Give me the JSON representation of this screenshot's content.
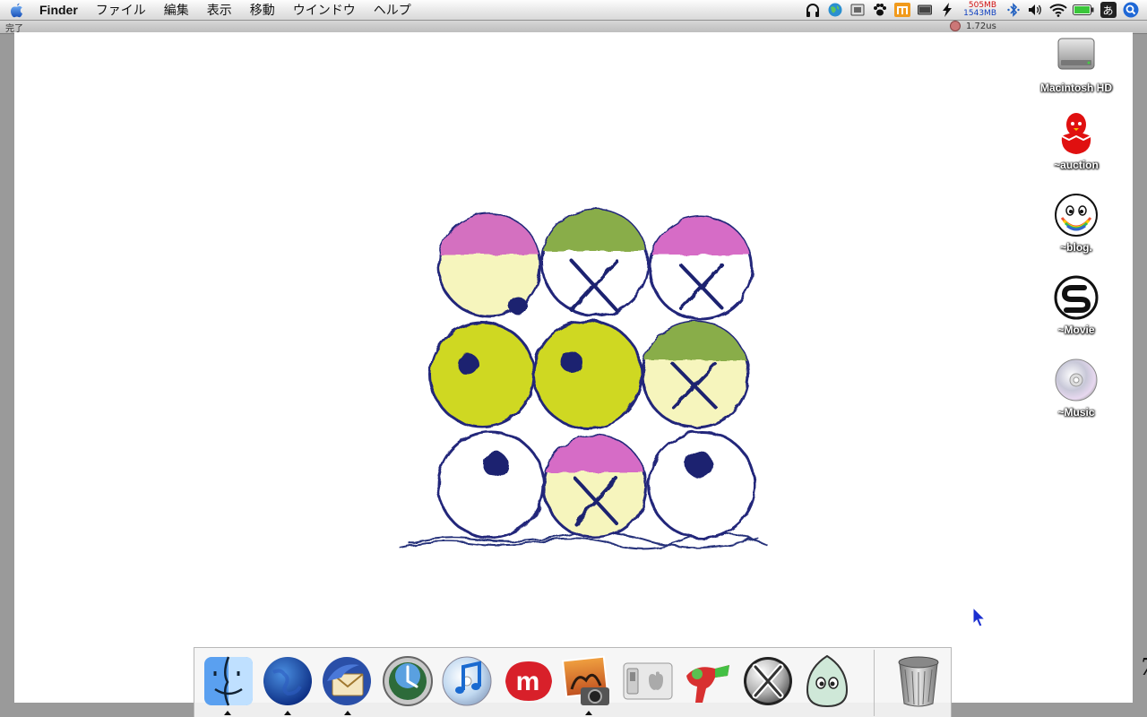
{
  "menubar": {
    "apple_icon": "apple-icon",
    "app_name": "Finder",
    "menus": [
      "ファイル",
      "編集",
      "表示",
      "移動",
      "ウインドウ",
      "ヘルプ"
    ],
    "status_icons": [
      "headphones-icon",
      "globe-icon",
      "display-icon",
      "paw-icon",
      "bars-icon",
      "battery-meter-icon",
      "bolt-icon"
    ],
    "memory_free": "505MB",
    "memory_total": "1543MB",
    "right_icons": [
      "bluetooth-icon",
      "volume-icon",
      "wifi-icon",
      "battery-icon"
    ],
    "input_method": "あ",
    "spotlight_icon": "spotlight-icon"
  },
  "background_window": {
    "title": "完了",
    "time": "1.72us"
  },
  "desktop": {
    "icons": [
      {
        "label": "Macintosh HD",
        "icon": "hard-drive-icon"
      },
      {
        "label": "~auction",
        "icon": "red-bird-icon"
      },
      {
        "label": "~blog.",
        "icon": "smiley-icon"
      },
      {
        "label": "~Movie",
        "icon": "s-logo-icon"
      },
      {
        "label": "~Music",
        "icon": "cd-icon"
      }
    ],
    "edge_glyph": "7"
  },
  "dock": {
    "apps": [
      {
        "name": "Finder",
        "icon": "finder-icon",
        "running": true
      },
      {
        "name": "Firefox",
        "icon": "firefox-icon",
        "running": true
      },
      {
        "name": "Thunderbird",
        "icon": "thunderbird-icon",
        "running": true
      },
      {
        "name": "Time Machine",
        "icon": "time-machine-icon",
        "running": false
      },
      {
        "name": "iTunes",
        "icon": "itunes-icon",
        "running": false
      },
      {
        "name": "Miro",
        "icon": "miro-icon",
        "running": false
      },
      {
        "name": "iPhoto",
        "icon": "iphoto-icon",
        "running": true
      },
      {
        "name": "System Preferences",
        "icon": "switch-icon",
        "running": false
      },
      {
        "name": "Ray Gun",
        "icon": "raygun-icon",
        "running": false
      },
      {
        "name": "X11",
        "icon": "x11-icon",
        "running": false
      },
      {
        "name": "Adium",
        "icon": "adium-icon",
        "running": false
      }
    ],
    "trash": {
      "name": "Trash",
      "icon": "trash-icon"
    }
  }
}
